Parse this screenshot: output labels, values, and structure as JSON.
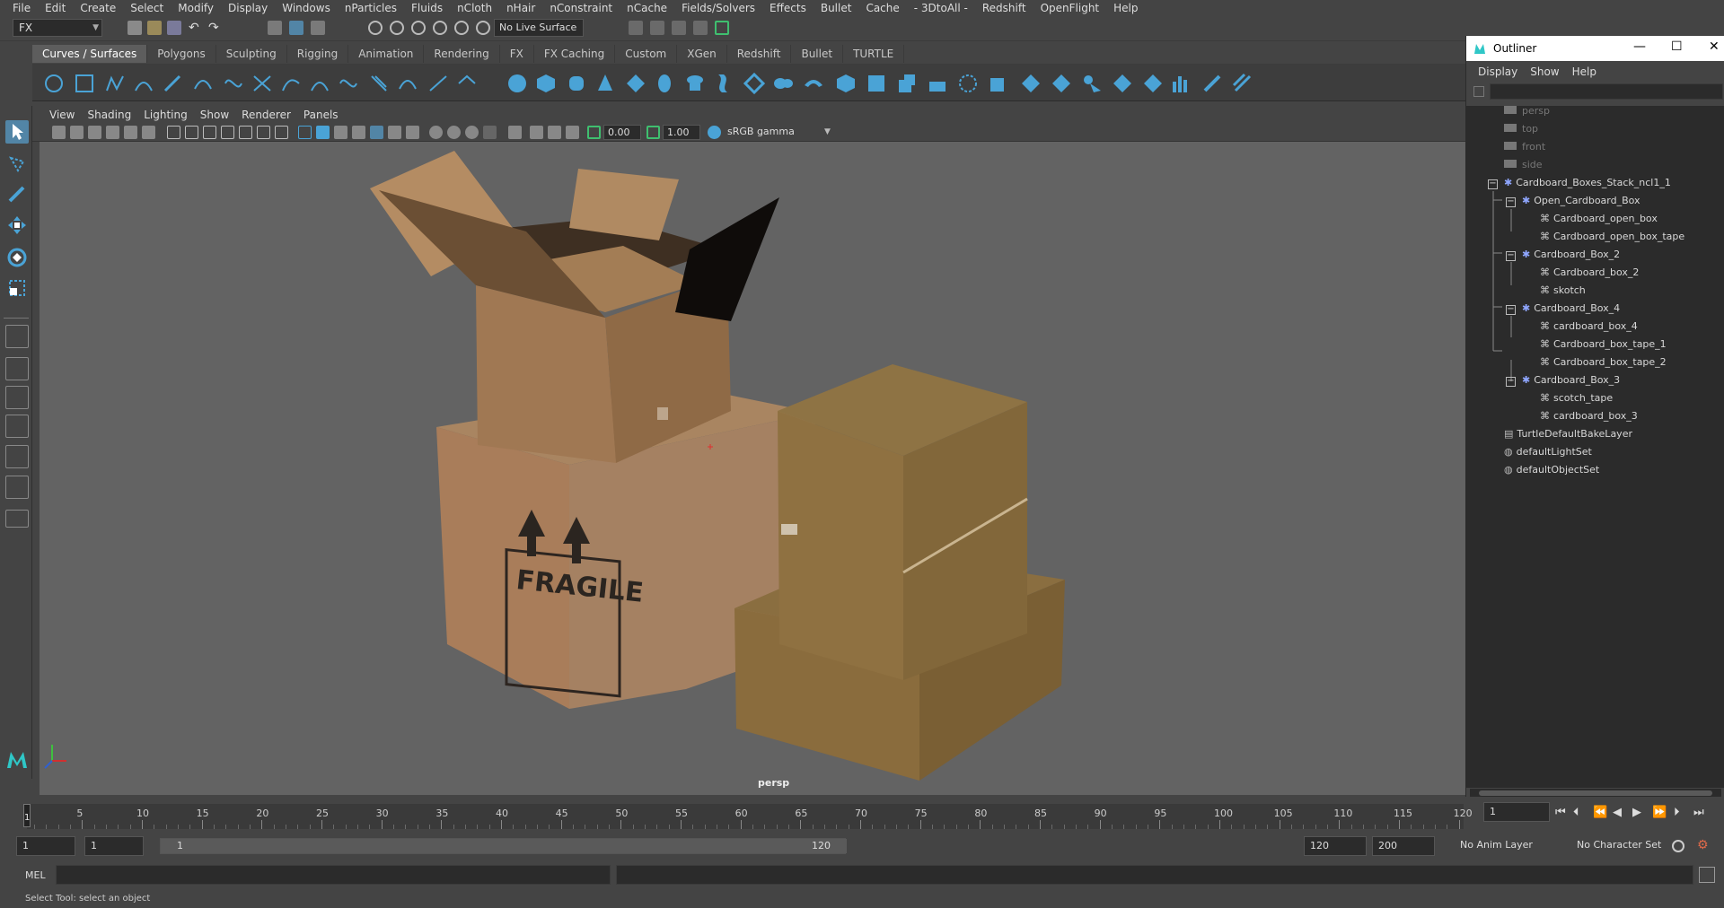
{
  "menubar": {
    "items": [
      "File",
      "Edit",
      "Create",
      "Select",
      "Modify",
      "Display",
      "Windows",
      "nParticles",
      "Fluids",
      "nCloth",
      "nHair",
      "nConstraint",
      "nCache",
      "Fields/Solvers",
      "Effects",
      "Bullet",
      "Cache",
      "- 3DtoAll -",
      "Redshift",
      "OpenFlight",
      "Help"
    ]
  },
  "statusline": {
    "mode": "FX",
    "live_surface": "No Live Surface"
  },
  "shelf": {
    "tabs": [
      "Curves / Surfaces",
      "Polygons",
      "Sculpting",
      "Rigging",
      "Animation",
      "Rendering",
      "FX",
      "FX Caching",
      "Custom",
      "XGen",
      "Redshift",
      "Bullet",
      "TURTLE"
    ],
    "active_tab": "Curves / Surfaces"
  },
  "panel_menu": [
    "View",
    "Shading",
    "Lighting",
    "Show",
    "Renderer",
    "Panels"
  ],
  "panel_toolbar": {
    "exposure": "0.00",
    "gamma": "1.00",
    "color_space": "sRGB gamma"
  },
  "viewport": {
    "camera_label": "persp",
    "box_label": "FRAGILE"
  },
  "outliner": {
    "title": "Outliner",
    "menu": [
      "Display",
      "Show",
      "Help"
    ],
    "items": {
      "persp": "persp",
      "top": "top",
      "front": "front",
      "side": "side",
      "root": "Cardboard_Boxes_Stack_ncl1_1",
      "open_group": "Open_Cardboard_Box",
      "open_box": "Cardboard_open_box",
      "open_box_tape": "Cardboard_open_box_tape",
      "box2_group": "Cardboard_Box_2",
      "box2": "Cardboard_box_2",
      "skotch": "skotch",
      "box4_group": "Cardboard_Box_4",
      "box4": "cardboard_box_4",
      "box4_tape1": "Cardboard_box_tape_1",
      "box4_tape2": "Cardboard_box_tape_2",
      "box3_group": "Cardboard_Box_3",
      "scotch_tape": "scotch_tape",
      "box3": "cardboard_box_3",
      "turtle": "TurtleDefaultBakeLayer",
      "light_set": "defaultLightSet",
      "object_set": "defaultObjectSet"
    }
  },
  "timeline": {
    "ticks": [
      "5",
      "10",
      "15",
      "20",
      "25",
      "30",
      "35",
      "40",
      "45",
      "50",
      "55",
      "60",
      "65",
      "70",
      "75",
      "80",
      "85",
      "90",
      "95",
      "100",
      "105",
      "110",
      "115",
      "120"
    ],
    "current_frame_marker": "1",
    "current_frame_field": "1"
  },
  "range": {
    "start": "1",
    "start_inner": "1",
    "thumb_start": "1",
    "thumb_end": "120",
    "end_inner": "120",
    "end": "200",
    "anim_layer": "No Anim Layer",
    "character_set": "No Character Set"
  },
  "commandline": {
    "label": "MEL"
  },
  "helpline": {
    "text": "Select Tool: select an object"
  },
  "colors": {
    "accent": "#5285a6",
    "shelf_icon": "#4aa3d6",
    "viewport_bg": "#636363"
  }
}
